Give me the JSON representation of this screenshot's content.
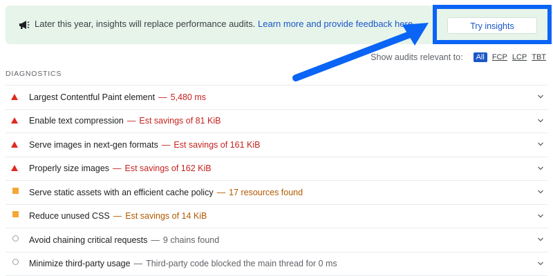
{
  "banner": {
    "icon": "megaphone-icon",
    "text": "Later this year, insights will replace performance audits.",
    "link": "Learn more and provide feedback here.",
    "button": "Try insights",
    "highlight_color": "#0a64f5"
  },
  "filters": {
    "label": "Show audits relevant to:",
    "options": [
      "All",
      "FCP",
      "LCP",
      "TBT"
    ],
    "selected": "All"
  },
  "section": {
    "title": "DIAGNOSTICS"
  },
  "audits": [
    {
      "title": "Largest Contentful Paint element",
      "detail": "5,480 ms",
      "status": "fail"
    },
    {
      "title": "Enable text compression",
      "detail": "Est savings of 81 KiB",
      "status": "fail"
    },
    {
      "title": "Serve images in next-gen formats",
      "detail": "Est savings of 161 KiB",
      "status": "fail"
    },
    {
      "title": "Properly size images",
      "detail": "Est savings of 162 KiB",
      "status": "fail"
    },
    {
      "title": "Serve static assets with an efficient cache policy",
      "detail": "17 resources found",
      "status": "warn"
    },
    {
      "title": "Reduce unused CSS",
      "detail": "Est savings of 14 KiB",
      "status": "warn"
    },
    {
      "title": "Avoid chaining critical requests",
      "detail": "9 chains found",
      "status": "info"
    },
    {
      "title": "Minimize third-party usage",
      "detail": "Third-party code blocked the main thread for 0 ms",
      "status": "info"
    }
  ],
  "separator": "—"
}
